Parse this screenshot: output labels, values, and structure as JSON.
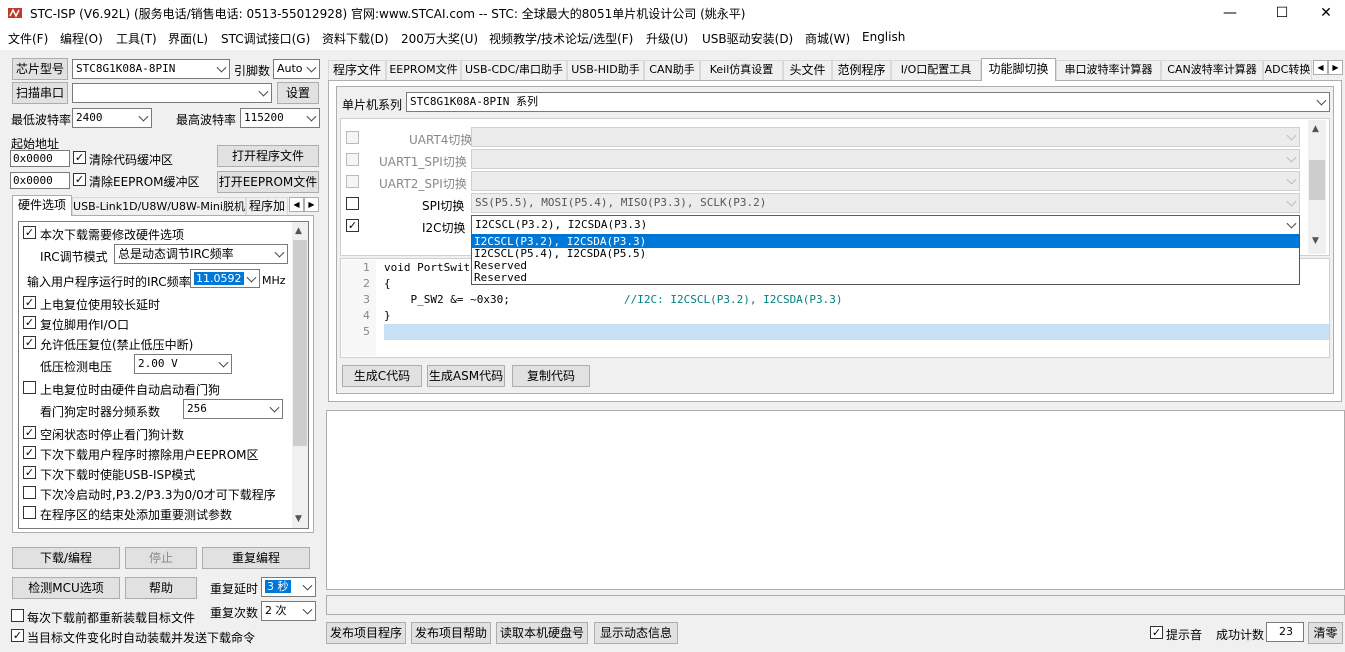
{
  "window": {
    "title": "STC-ISP (V6.92L) (服务电话/销售电话: 0513-55012928) 官网:www.STCAI.com  -- STC: 全球最大的8051单片机设计公司 (姚永平)",
    "minimize": "—",
    "maximize": "☐",
    "close": "✕"
  },
  "menu": [
    "文件(F)",
    "编程(O)",
    "工具(T)",
    "界面(L)",
    "STC调试接口(G)",
    "资料下载(D)",
    "200万大奖(U)",
    "视频教学/技术论坛/选型(F)",
    "升级(U)",
    "USB驱动安装(D)",
    "商城(W)",
    "English"
  ],
  "left": {
    "chip_button": "芯片型号",
    "chip_value": "STC8G1K08A-8PIN",
    "pin_label": "引脚数",
    "pin_value": "Auto",
    "scan_button": "扫描串口",
    "port_value": "",
    "settings_button": "设置",
    "min_baud_label": "最低波特率",
    "min_baud_value": "2400",
    "max_baud_label": "最高波特率",
    "max_baud_value": "115200",
    "start_addr_label": "起始地址",
    "addr1": "0x0000",
    "clear_code_label": "清除代码缓冲区",
    "open_program": "打开程序文件",
    "addr2": "0x0000",
    "clear_eeprom_label": "清除EEPROM缓冲区",
    "open_eeprom": "打开EEPROM文件",
    "tabs": [
      "硬件选项",
      "USB-Link1D/U8W/U8W-Mini脱机",
      "程序加"
    ],
    "hw": {
      "opt_modify": "本次下载需要修改硬件选项",
      "irc_mode_label": "IRC调节模式",
      "irc_mode_value": "总是动态调节IRC频率",
      "irc_freq_label": "输入用户程序运行时的IRC频率",
      "irc_freq_value": "11.0592",
      "irc_unit": "MHz",
      "opt_long_delay": "上电复位使用较长延时",
      "opt_reset_io": "复位脚用作I/O口",
      "opt_lvr": "允许低压复位(禁止低压中断)",
      "lvd_label": "低压检测电压",
      "lvd_value": "2.00 V",
      "opt_wdt": "上电复位时由硬件自动启动看门狗",
      "wdt_div_label": "看门狗定时器分频系数",
      "wdt_div_value": "256",
      "opt_idle_wdt": "空闲状态时停止看门狗计数",
      "opt_erase_eeprom": "下次下载用户程序时擦除用户EEPROM区",
      "opt_usb_isp": "下次下载时使能USB-ISP模式",
      "opt_cold_boot": "下次冷启动时,P3.2/P3.3为0/0才可下载程序",
      "opt_test_params": "在程序区的结束处添加重要测试参数"
    },
    "download_button": "下载/编程",
    "stop_button": "停止",
    "reprogram_button": "重复编程",
    "check_mcu_button": "检测MCU选项",
    "help_button": "帮助",
    "repeat_delay_label": "重复延时",
    "repeat_delay_value": "3 秒",
    "repeat_count_label": "重复次数",
    "repeat_count_value": "2 次",
    "reload_label": "每次下载前都重新装载目标文件",
    "auto_load_label": "当目标文件变化时自动装载并发送下载命令"
  },
  "right": {
    "tabs": [
      "程序文件",
      "EEPROM文件",
      "USB-CDC/串口助手",
      "USB-HID助手",
      "CAN助手",
      "Keil仿真设置",
      "头文件",
      "范例程序",
      "I/O口配置工具",
      "功能脚切换",
      "串口波特率计算器",
      "CAN波特率计算器",
      "ADC转换"
    ],
    "series_label": "单片机系列",
    "series_value": "STC8G1K08A-8PIN 系列",
    "rows": [
      {
        "label": "UART4切换",
        "value": ""
      },
      {
        "label": "UART1_SPI切换",
        "value": ""
      },
      {
        "label": "UART2_SPI切换",
        "value": ""
      },
      {
        "label": "SPI切换",
        "value": "SS(P5.5), MOSI(P5.4), MISO(P3.3), SCLK(P3.2)"
      },
      {
        "label": "I2C切换",
        "value": "I2CSCL(P3.2), I2CSDA(P3.3)"
      }
    ],
    "dropdown": [
      "I2CSCL(P3.2), I2CSDA(P3.3)",
      "I2CSCL(P5.4), I2CSDA(P5.5)",
      "Reserved",
      "Reserved"
    ],
    "code": {
      "line_numbers": [
        "1",
        "2",
        "3",
        "4",
        "5"
      ],
      "lines": [
        "void PortSwitch",
        "{",
        "    P_SW2 &= ~0x30;",
        "}",
        ""
      ],
      "comment": "//I2C: I2CSCL(P3.2), I2CSDA(P3.3)"
    },
    "gen_c": "生成C代码",
    "gen_asm": "生成ASM代码",
    "copy_code": "复制代码"
  },
  "bottom": {
    "publish_program": "发布项目程序",
    "publish_help": "发布项目帮助",
    "read_disk": "读取本机硬盘号",
    "show_dynamic": "显示动态信息",
    "tip_sound_label": "提示音",
    "success_count_label": "成功计数",
    "success_count_value": "23",
    "clear_button": "清零"
  },
  "colors": {
    "selection": "#0078d7",
    "code_highlight": "#c7e0f4",
    "comment": "#008080"
  }
}
